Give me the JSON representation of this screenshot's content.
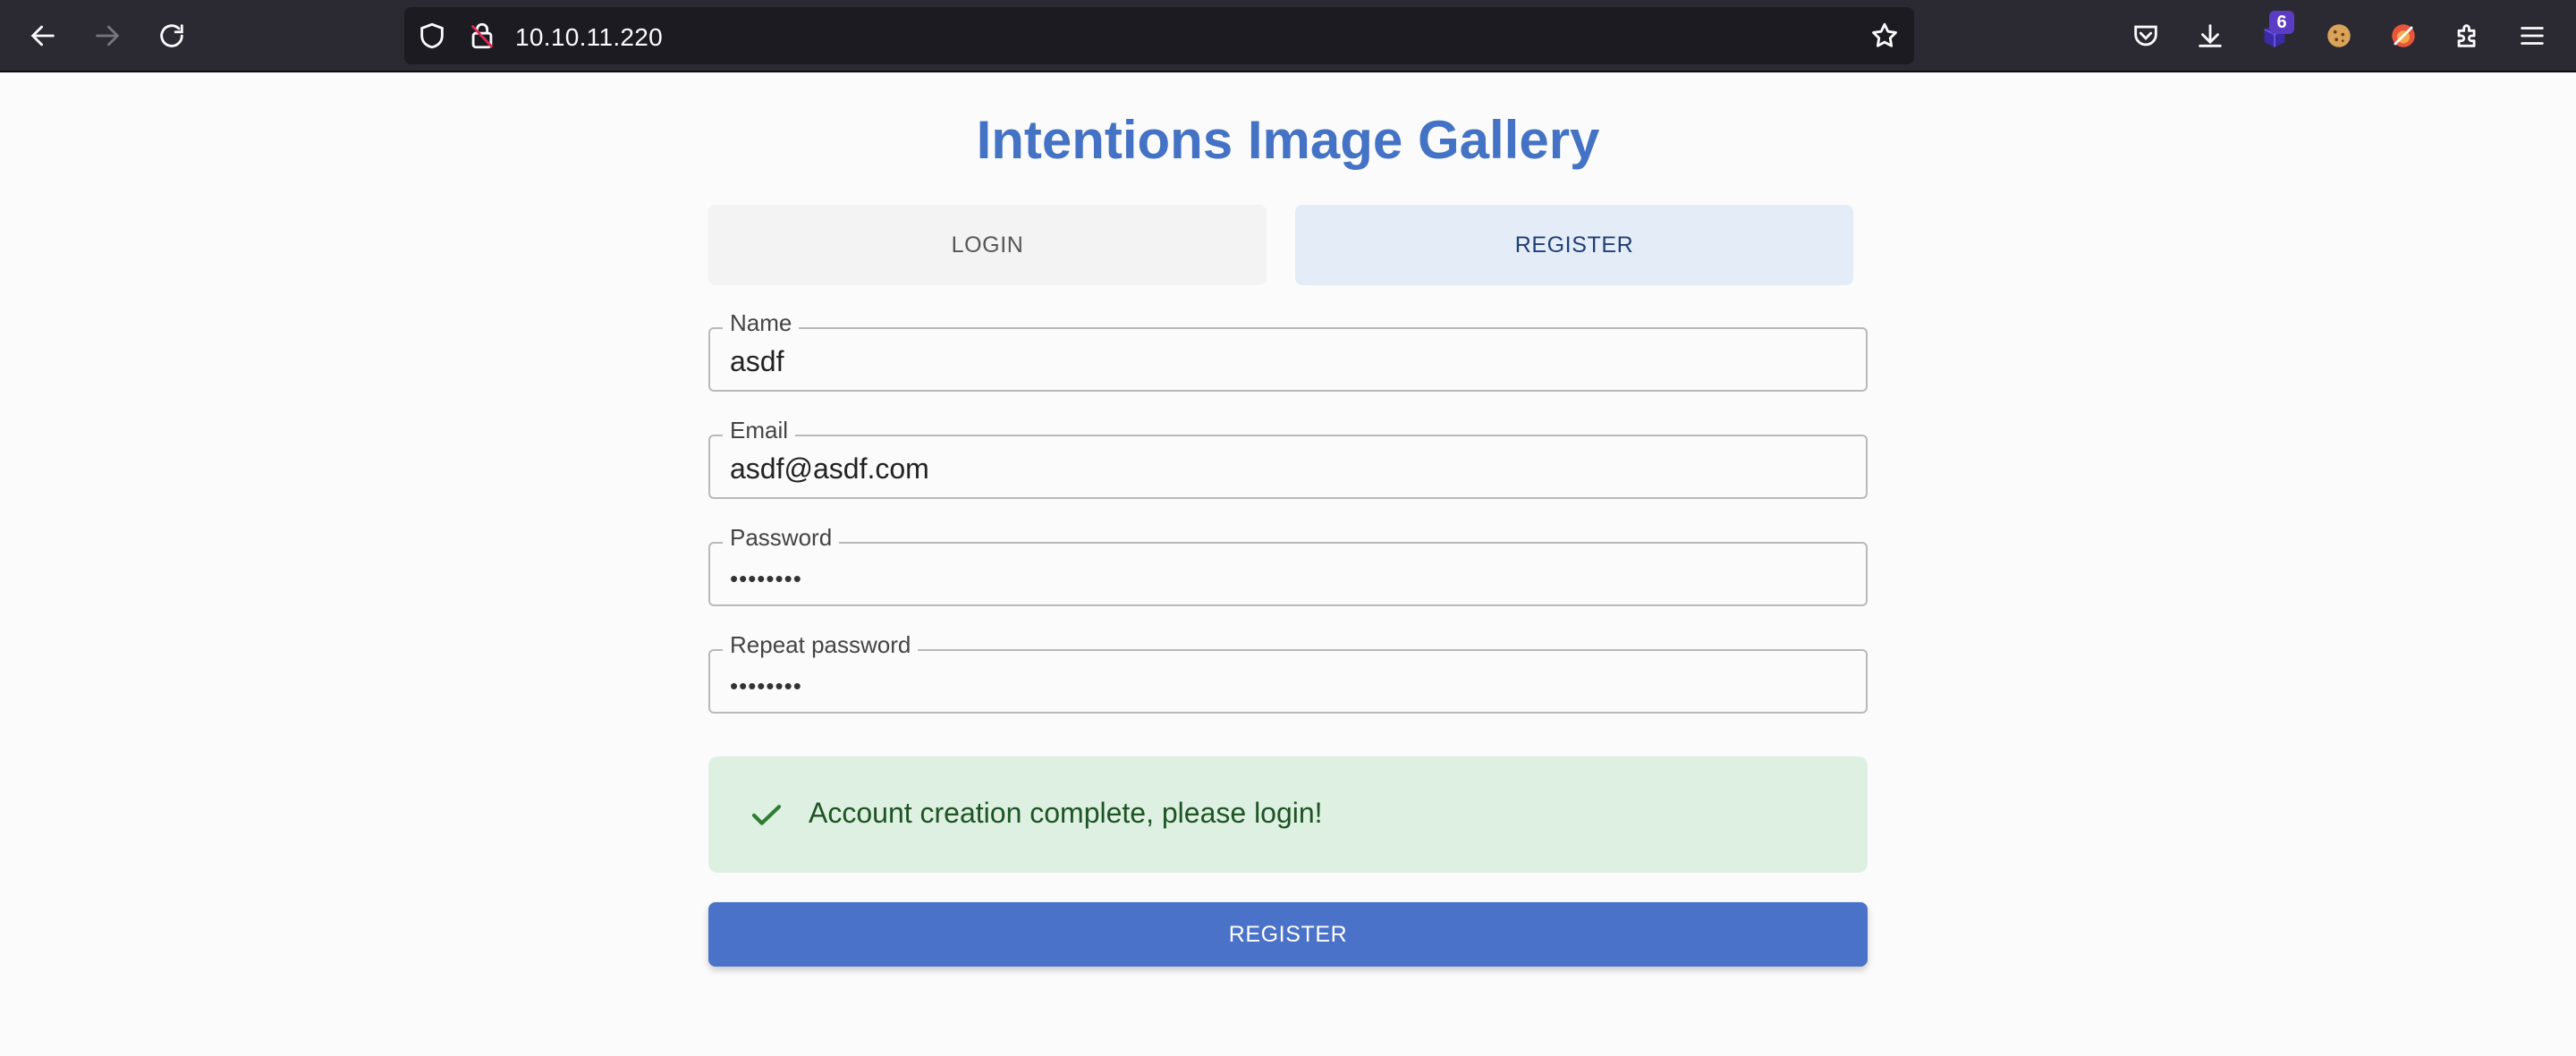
{
  "browser": {
    "url": "10.10.11.220",
    "extension_badge": "6"
  },
  "page": {
    "title": "Intentions Image Gallery",
    "tabs": {
      "login": "LOGIN",
      "register": "REGISTER"
    },
    "form": {
      "name": {
        "label": "Name",
        "value": "asdf"
      },
      "email": {
        "label": "Email",
        "value": "asdf@asdf.com"
      },
      "password": {
        "label": "Password",
        "value": "••••••••"
      },
      "repeat_password": {
        "label": "Repeat password",
        "value": "••••••••"
      }
    },
    "alert": {
      "message": "Account creation complete, please login!"
    },
    "submit_label": "REGISTER"
  }
}
